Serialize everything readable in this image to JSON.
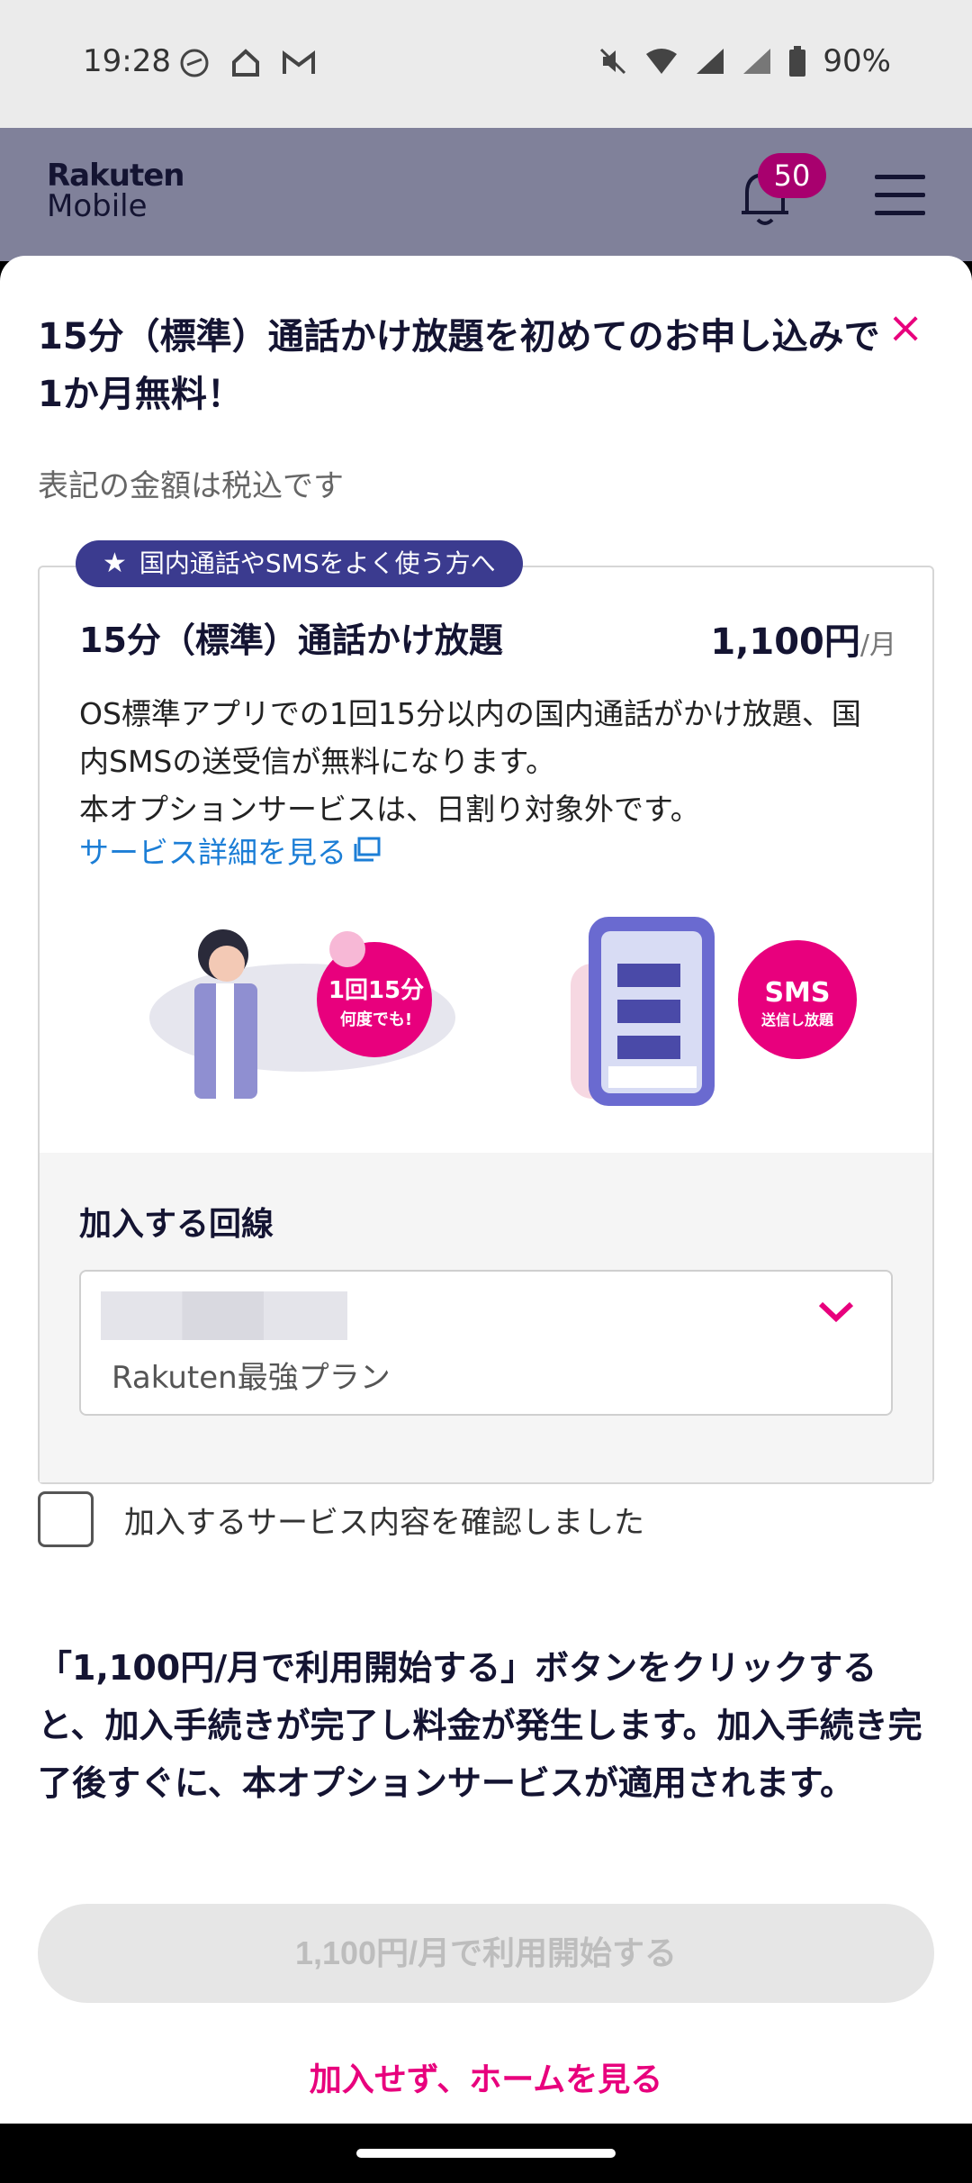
{
  "status_bar": {
    "time": "19:28",
    "battery": "90%",
    "icons": [
      "link-icon",
      "home-icon",
      "gmail-icon",
      "mute-icon",
      "wifi-icon",
      "signal-icon",
      "battery-icon"
    ]
  },
  "header": {
    "logo_line1": "Rakuten",
    "logo_line2": "Mobile",
    "notification_count": "50"
  },
  "dialog": {
    "title": "15分（標準）通話かけ放題を初めてのお申し込みで1か月無料！",
    "tax_note": "表記の金額は税込です",
    "card": {
      "tag": "国内通話やSMSをよく使う方へ",
      "plan_name": "15分（標準）通話かけ放題",
      "price": "1,100円",
      "price_unit": "/月",
      "description_line1": "OS標準アプリでの1回15分以内の国内通話がかけ放題、国内SMSの送受信が無料になります。",
      "description_line2": "本オプションサービスは、日割り対象外です。",
      "detail_link": "サービス詳細を見る",
      "illustration_left_badge_line1": "1回15分",
      "illustration_left_badge_line2": "何度でも!",
      "illustration_right_badge_line1": "SMS",
      "illustration_right_badge_line2": "送信し放題",
      "line_label": "加入する回線",
      "line_select_value": "Rakuten最強プラン"
    },
    "confirm_label": "加入するサービス内容を確認しました",
    "notice": "「1,100円/月で利用開始する」ボタンをクリックすると、加入手続きが完了し料金が発生します。加入手続き完了後すぐに、本オプションサービスが適用されます。",
    "start_button": "1,100円/月で利用開始する",
    "skip_link": "加入せず、ホームを見る"
  },
  "colors": {
    "accent_pink": "#e8007d",
    "tag_navy": "#3b3b8f",
    "badge": "#a8006e",
    "link_blue": "#1c7ed6"
  }
}
